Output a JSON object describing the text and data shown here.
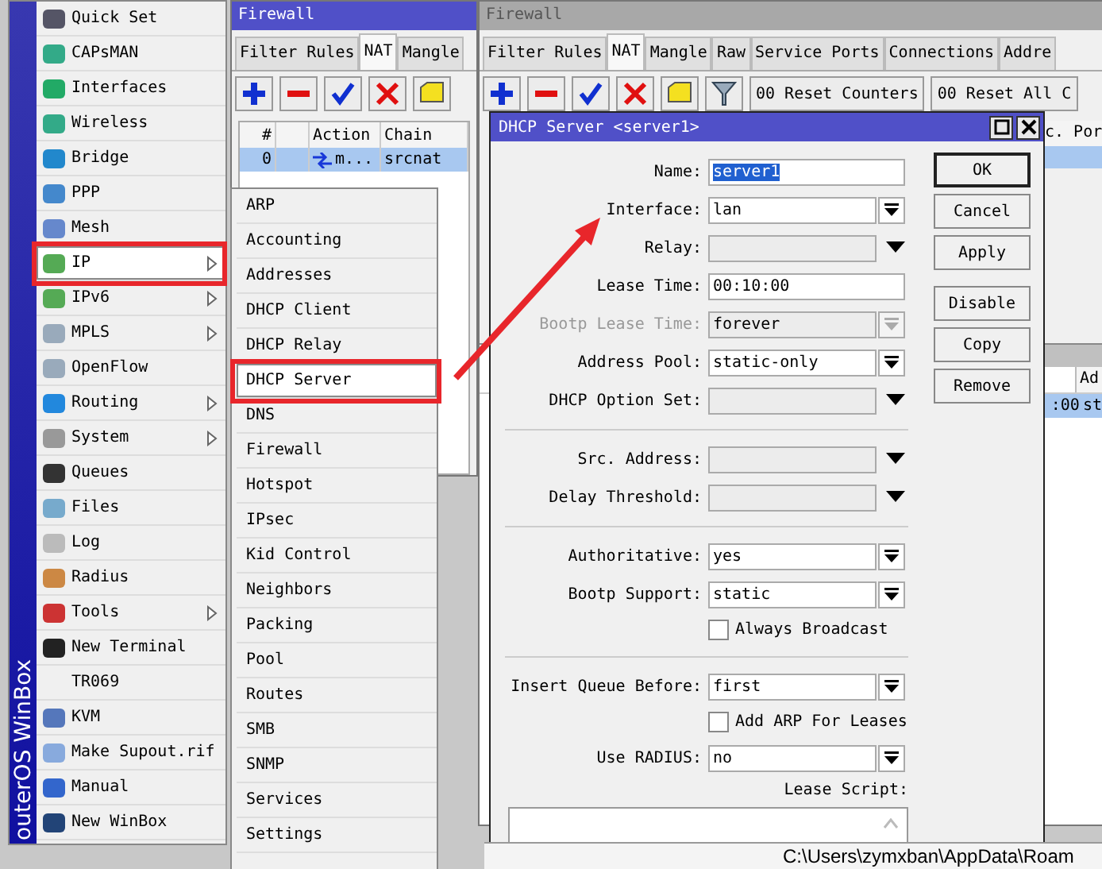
{
  "main_menu": {
    "brand": "outerOS WinBox",
    "items": [
      {
        "label": "Quick Set",
        "has_icon": true,
        "submenu": false,
        "selected": false
      },
      {
        "label": "CAPsMAN",
        "has_icon": true,
        "submenu": false,
        "selected": false
      },
      {
        "label": "Interfaces",
        "has_icon": true,
        "submenu": false,
        "selected": false
      },
      {
        "label": "Wireless",
        "has_icon": true,
        "submenu": false,
        "selected": false
      },
      {
        "label": "Bridge",
        "has_icon": true,
        "submenu": false,
        "selected": false
      },
      {
        "label": "PPP",
        "has_icon": true,
        "submenu": false,
        "selected": false
      },
      {
        "label": "Mesh",
        "has_icon": true,
        "submenu": false,
        "selected": false
      },
      {
        "label": "IP",
        "has_icon": true,
        "submenu": true,
        "selected": true
      },
      {
        "label": "IPv6",
        "has_icon": true,
        "submenu": true,
        "selected": false
      },
      {
        "label": "MPLS",
        "has_icon": true,
        "submenu": true,
        "selected": false
      },
      {
        "label": "OpenFlow",
        "has_icon": true,
        "submenu": false,
        "selected": false
      },
      {
        "label": "Routing",
        "has_icon": true,
        "submenu": true,
        "selected": false
      },
      {
        "label": "System",
        "has_icon": true,
        "submenu": true,
        "selected": false
      },
      {
        "label": "Queues",
        "has_icon": true,
        "submenu": false,
        "selected": false
      },
      {
        "label": "Files",
        "has_icon": true,
        "submenu": false,
        "selected": false
      },
      {
        "label": "Log",
        "has_icon": true,
        "submenu": false,
        "selected": false
      },
      {
        "label": "Radius",
        "has_icon": true,
        "submenu": false,
        "selected": false
      },
      {
        "label": "Tools",
        "has_icon": true,
        "submenu": true,
        "selected": false
      },
      {
        "label": "New Terminal",
        "has_icon": true,
        "submenu": false,
        "selected": false
      },
      {
        "label": "TR069",
        "has_icon": false,
        "submenu": false,
        "selected": false
      },
      {
        "label": "KVM",
        "has_icon": true,
        "submenu": false,
        "selected": false
      },
      {
        "label": "Make Supout.rif",
        "has_icon": true,
        "submenu": false,
        "selected": false
      },
      {
        "label": "Manual",
        "has_icon": true,
        "submenu": false,
        "selected": false
      },
      {
        "label": "New WinBox",
        "has_icon": true,
        "submenu": false,
        "selected": false
      }
    ]
  },
  "ip_submenu": {
    "items": [
      {
        "label": "ARP",
        "selected": false
      },
      {
        "label": "Accounting",
        "selected": false
      },
      {
        "label": "Addresses",
        "selected": false
      },
      {
        "label": "DHCP Client",
        "selected": false
      },
      {
        "label": "DHCP Relay",
        "selected": false
      },
      {
        "label": "DHCP Server",
        "selected": true
      },
      {
        "label": "DNS",
        "selected": false
      },
      {
        "label": "Firewall",
        "selected": false
      },
      {
        "label": "Hotspot",
        "selected": false
      },
      {
        "label": "IPsec",
        "selected": false
      },
      {
        "label": "Kid Control",
        "selected": false
      },
      {
        "label": "Neighbors",
        "selected": false
      },
      {
        "label": "Packing",
        "selected": false
      },
      {
        "label": "Pool",
        "selected": false
      },
      {
        "label": "Routes",
        "selected": false
      },
      {
        "label": "SMB",
        "selected": false
      },
      {
        "label": "SNMP",
        "selected": false
      },
      {
        "label": "Services",
        "selected": false
      },
      {
        "label": "Settings",
        "selected": false
      }
    ]
  },
  "firewall_back": {
    "title": "Firewall",
    "tabs": [
      {
        "label": "Filter Rules",
        "selected": false
      },
      {
        "label": "NAT",
        "selected": true
      },
      {
        "label": "Mangle",
        "selected": false
      },
      {
        "label": "Raw",
        "selected": false
      },
      {
        "label": "Service Ports",
        "selected": false
      },
      {
        "label": "Connections",
        "selected": false
      },
      {
        "label": "Addre",
        "selected": false
      }
    ],
    "toolbar_buttons": [
      "00 Reset Counters",
      "00 Reset All C"
    ],
    "column_fragment": "c. Por"
  },
  "lease_list_back": {
    "column_fragment": "Ad",
    "row_fragments": [
      ":00",
      "st"
    ]
  },
  "firewall_front": {
    "title": "Firewall",
    "tabs": [
      {
        "label": "Filter Rules",
        "selected": false
      },
      {
        "label": "NAT",
        "selected": true
      },
      {
        "label": "Mangle",
        "selected": false
      }
    ],
    "columns": [
      "#",
      "",
      "Action",
      "Chain"
    ],
    "rows": [
      {
        "cells": [
          "0",
          "",
          "m...",
          "srcnat"
        ],
        "selected": true
      }
    ]
  },
  "dhcp_dialog": {
    "title": "DHCP Server <server1>",
    "fields": [
      {
        "kind": "text",
        "label": "Name:",
        "value": "server1",
        "highlighted": true
      },
      {
        "kind": "select",
        "label": "Interface:",
        "value": "lan",
        "disabled": false
      },
      {
        "kind": "combo",
        "label": "Relay:"
      },
      {
        "kind": "text",
        "label": "Lease Time:",
        "value": "00:10:00",
        "highlighted": false
      },
      {
        "kind": "select",
        "label": "Bootp Lease Time:",
        "value": "forever",
        "disabled": true
      },
      {
        "kind": "select",
        "label": "Address Pool:",
        "value": "static-only",
        "disabled": false
      },
      {
        "kind": "combo",
        "label": "DHCP Option Set:"
      },
      {
        "kind": "divider"
      },
      {
        "kind": "combo",
        "label": "Src. Address:"
      },
      {
        "kind": "combo",
        "label": "Delay Threshold:"
      },
      {
        "kind": "divider"
      },
      {
        "kind": "select",
        "label": "Authoritative:",
        "value": "yes",
        "disabled": false
      },
      {
        "kind": "select",
        "label": "Bootp Support:",
        "value": "static",
        "disabled": false
      },
      {
        "kind": "checkbox",
        "label": "Always Broadcast",
        "checked": false
      },
      {
        "kind": "divider"
      },
      {
        "kind": "select",
        "label": "Insert Queue Before:",
        "value": "first",
        "disabled": false
      },
      {
        "kind": "checkbox",
        "label": "Add ARP For Leases",
        "checked": false
      },
      {
        "kind": "select",
        "label": "Use RADIUS:",
        "value": "no",
        "disabled": false
      },
      {
        "kind": "textarea",
        "label": "Lease Script:"
      }
    ],
    "buttons": [
      {
        "label": "OK",
        "default": true
      },
      {
        "label": "Cancel",
        "default": false
      },
      {
        "label": "Apply",
        "default": false
      },
      {
        "label": "Disable",
        "default": false
      },
      {
        "label": "Copy",
        "default": false
      },
      {
        "label": "Remove",
        "default": false
      }
    ]
  },
  "status_bar": {
    "path": "C:\\Users\\zymxban\\AppData\\Roam"
  }
}
